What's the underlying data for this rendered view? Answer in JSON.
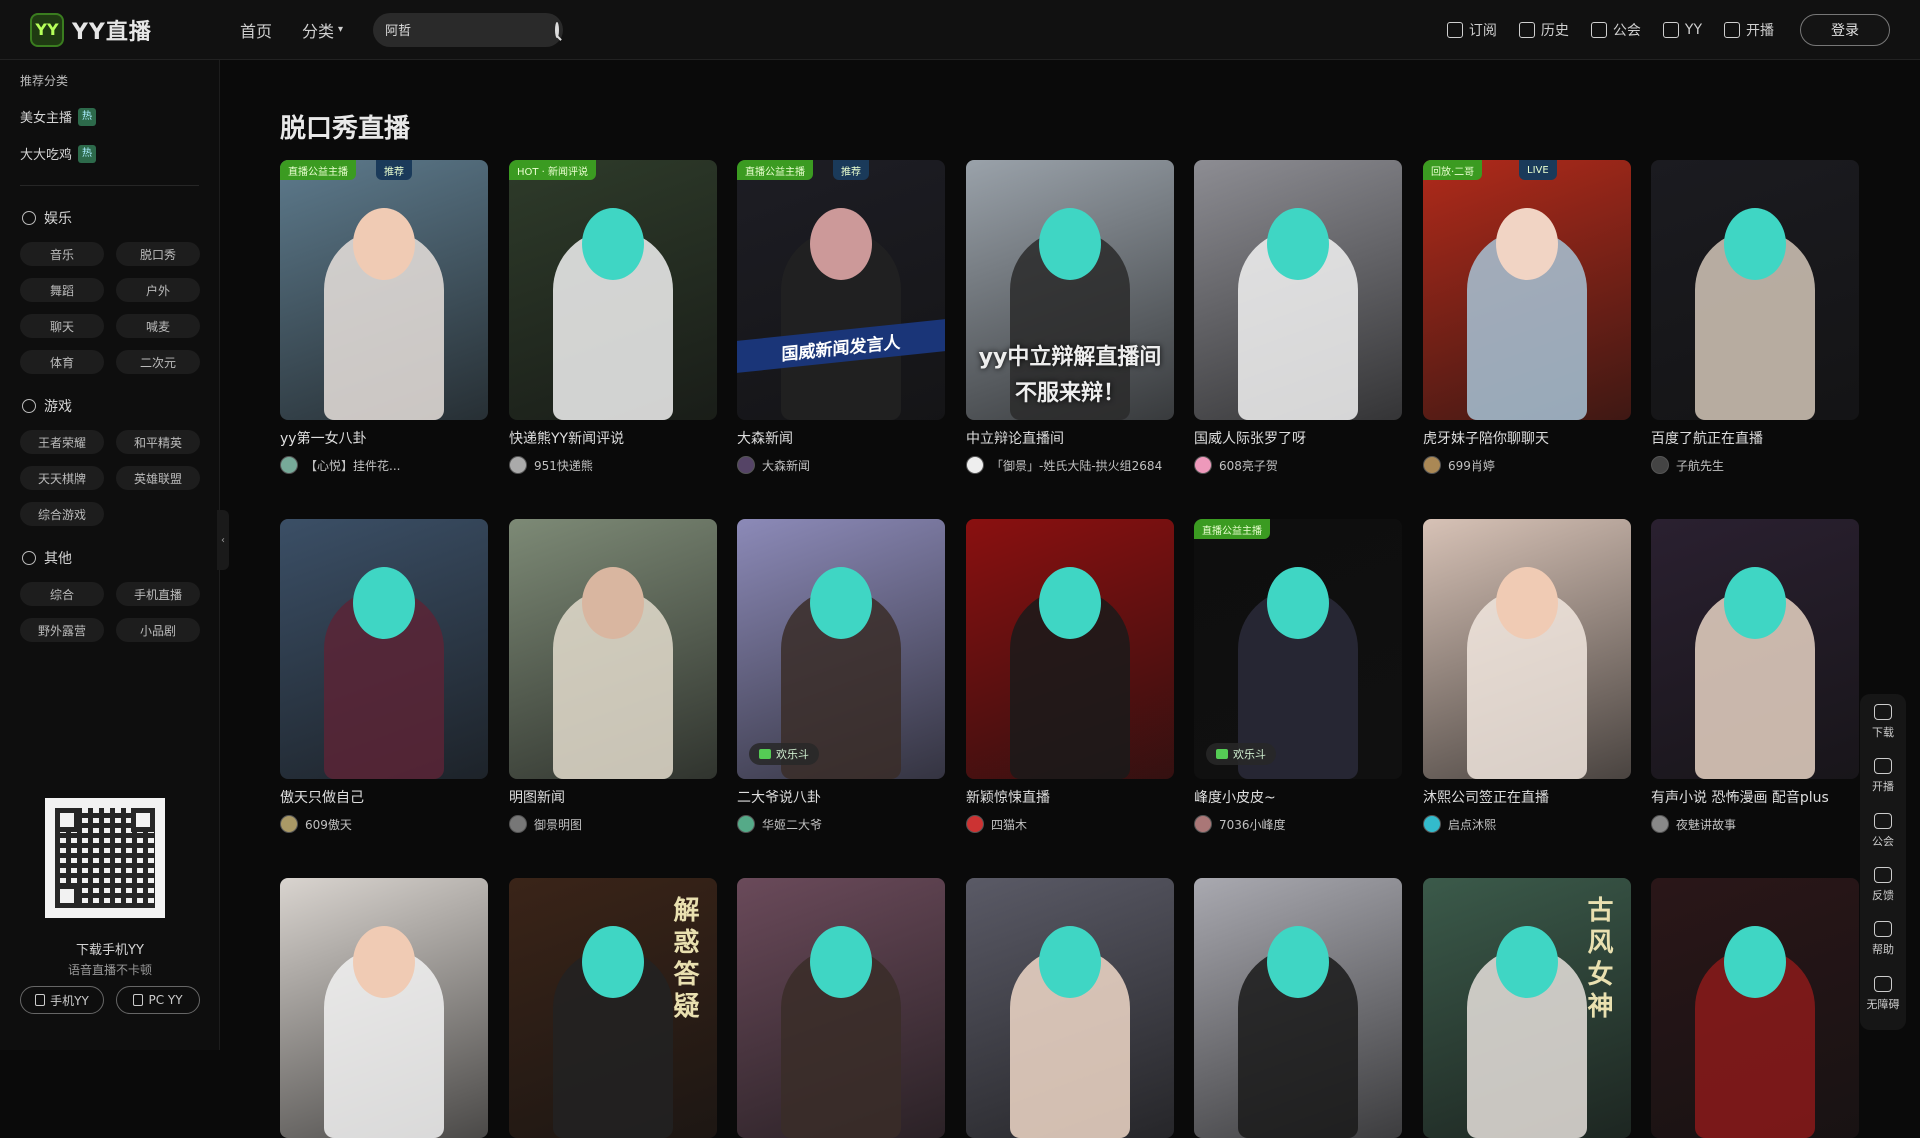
{
  "header": {
    "logo_mark": "YY",
    "logo_text": "YY直播",
    "nav_home": "首页",
    "nav_category": "分类",
    "search_value": "阿哲",
    "right_items": [
      {
        "label": "订阅",
        "icon": "subscribe-icon"
      },
      {
        "label": "历史",
        "icon": "history-icon"
      },
      {
        "label": "公会",
        "icon": "guild-icon"
      },
      {
        "label": "YY",
        "icon": "yy-icon"
      },
      {
        "label": "开播",
        "icon": "start-live-icon"
      }
    ],
    "login_label": "登录"
  },
  "sidebar": {
    "recommend_title": "推荐分类",
    "recommend_items": [
      {
        "label": "美女主播",
        "badge": "热"
      },
      {
        "label": "大大吃鸡",
        "badge": "热"
      }
    ],
    "groups": [
      {
        "title": "娱乐",
        "items": [
          "音乐",
          "脱口秀",
          "舞蹈",
          "户外",
          "聊天",
          "喊麦",
          "体育",
          "二次元"
        ]
      },
      {
        "title": "游戏",
        "items": [
          "王者荣耀",
          "和平精英",
          "天天棋牌",
          "英雄联盟",
          "综合游戏"
        ]
      },
      {
        "title": "其他",
        "items": [
          "综合",
          "手机直播",
          "野外露营",
          "小品剧"
        ]
      }
    ],
    "collapse_glyph": "‹",
    "download_caption": "下载手机YY",
    "download_sub": "语音直播不卡顿",
    "btn_mobile": "手机YY",
    "btn_pc": "PC YY"
  },
  "main": {
    "section_title": "脱口秀直播",
    "cards": [
      {
        "title": "yy第一女八卦",
        "author": "【心悦】挂件花...",
        "tag": "直播公益主播",
        "tag2": "推荐",
        "thumb": "#5d7a8c",
        "fig": "#e8e0dc",
        "head": "#f0cbb4",
        "avatar": "#7a9"
      },
      {
        "title": "快递熊YY新闻评说",
        "author": "951快递熊",
        "tag": "HOT · 新闻评说",
        "thumb": "#2e3b2a",
        "fig": "#f2f2f2",
        "head": "#3fd6c4",
        "avatar": "#aaa"
      },
      {
        "title": "大森新闻",
        "author": "大森新闻",
        "tag": "直播公益主播",
        "tag2": "推荐",
        "thumb": "#1d1d24",
        "fig": "#222",
        "head": "#c99",
        "avatar": "#546",
        "banner": "国威新闻发言人"
      },
      {
        "title": "中立辩论直播间",
        "author": "「御景」-姓氏大陆-拱火组2684",
        "thumb": "#9aa2aa",
        "fig": "#2a2a2a",
        "head": "#3fd6c4",
        "avatar": "#eee",
        "overlay": [
          "yy中立辩解直播间",
          "不服来辩！"
        ]
      },
      {
        "title": "国威人际张罗了呀",
        "author": "608亮子贺",
        "thumb": "#8d8d93",
        "fig": "#f2f2f2",
        "head": "#3fd6c4",
        "avatar": "#e9b"
      },
      {
        "title": "虎牙妹子陪你聊聊天",
        "author": "699肖婷",
        "tag": "回放·二哥",
        "tag2": "LIVE",
        "thumb": "#b02a1a",
        "fig": "#a7c3d6",
        "head": "#f1d4c4",
        "avatar": "#a85"
      },
      {
        "title": "百度了航正在直播",
        "author": "子航先生",
        "thumb": "#1b1b20",
        "fig": "#d4c7b8",
        "head": "#3fd6c4",
        "avatar": "#444"
      },
      {
        "title": "傲天只做自己",
        "author": "609傲天",
        "thumb": "#3b4f66",
        "fig": "#5b2436",
        "head": "#3fd6c4",
        "avatar": "#a96"
      },
      {
        "title": "明图新闻",
        "author": "御景明图",
        "thumb": "#7d8a76",
        "fig": "#e3dccd",
        "head": "#d9b6a0",
        "avatar": "#777"
      },
      {
        "title": "二大爷说八卦",
        "author": "华姬二大爷",
        "thumb": "#8c8ab8",
        "fig": "#3a2d28",
        "head": "#3fd6c4",
        "avatar": "#5a8",
        "badge": "欢乐斗"
      },
      {
        "title": "新颖惊悚直播",
        "author": "四猫木",
        "thumb": "#8a1010",
        "fig": "#1a1a1a",
        "head": "#3fd6c4",
        "avatar": "#c33"
      },
      {
        "title": "峰度小皮皮~",
        "author": "7036小峰度",
        "tag": "直播公益主播",
        "thumb": "#0e0e0e",
        "fig": "#2a2a3a",
        "head": "#3fd6c4",
        "avatar": "#a77",
        "badge": "欢乐斗"
      },
      {
        "title": "沐熙公司签正在直播",
        "author": "启点沐熙",
        "thumb": "#d7c2b6",
        "fig": "#f1e6de",
        "head": "#f0cbb4",
        "avatar": "#3bc"
      },
      {
        "title": "有声小说 恐怖漫画 配音plus",
        "author": "夜魅讲故事",
        "thumb": "#2a2030",
        "fig": "#e8d4c4",
        "head": "#3fd6c4",
        "avatar": "#888"
      },
      {
        "title": "",
        "author": "",
        "thumb": "#d9d4cf",
        "fig": "#f2f2f2",
        "head": "#f0cbb4",
        "avatar": "#999"
      },
      {
        "title": "",
        "author": "",
        "thumb": "#3a2418",
        "fig": "#222",
        "head": "#3fd6c4",
        "avatar": "#999",
        "vertical_text": "解惑答疑"
      },
      {
        "title": "",
        "author": "",
        "thumb": "#6a4a5a",
        "fig": "#3a2d28",
        "head": "#3fd6c4",
        "avatar": "#999"
      },
      {
        "title": "",
        "author": "",
        "thumb": "#5a5a66",
        "fig": "#f0d8c8",
        "head": "#3fd6c4",
        "avatar": "#999"
      },
      {
        "title": "",
        "author": "",
        "thumb": "#a9a9b0",
        "fig": "#1a1a1a",
        "head": "#3fd6c4",
        "avatar": "#999"
      },
      {
        "title": "",
        "author": "",
        "thumb": "#3b5a4a",
        "fig": "#e6e0dc",
        "head": "#3fd6c4",
        "avatar": "#999",
        "vertical_text": "古风女神"
      },
      {
        "title": "",
        "author": "",
        "thumb": "#2a1618",
        "fig": "#8b1a1a",
        "head": "#3fd6c4",
        "avatar": "#999"
      }
    ]
  },
  "float_bar": [
    {
      "label": "下载",
      "icon": "download-icon"
    },
    {
      "label": "开播",
      "icon": "camera-icon"
    },
    {
      "label": "公会",
      "icon": "guild-shield-icon"
    },
    {
      "label": "反馈",
      "icon": "feedback-icon"
    },
    {
      "label": "帮助",
      "icon": "headset-icon"
    },
    {
      "label": "无障碍",
      "icon": "accessibility-icon"
    }
  ]
}
